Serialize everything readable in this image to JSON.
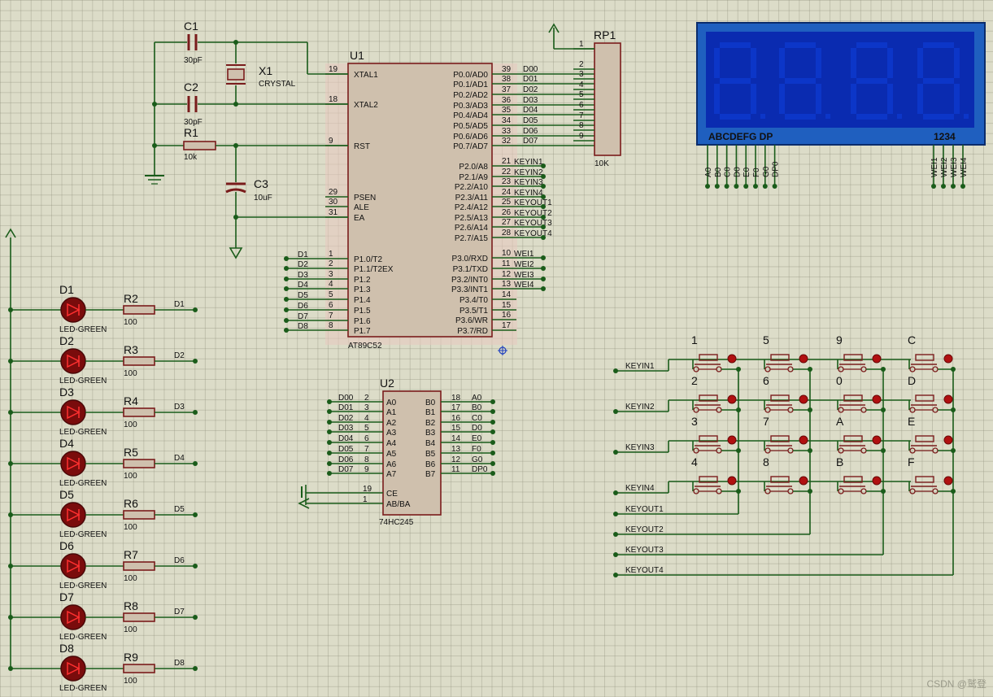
{
  "mcu": {
    "ref": "U1",
    "part": "AT89C52",
    "left_pins": [
      {
        "num": "19",
        "name": "XTAL1"
      },
      {
        "num": "18",
        "name": "XTAL2"
      },
      {
        "num": "9",
        "name": "RST"
      },
      {
        "num": "29",
        "name": "PSEN"
      },
      {
        "num": "30",
        "name": "ALE"
      },
      {
        "num": "31",
        "name": "EA"
      },
      {
        "num": "1",
        "name": "P1.0/T2"
      },
      {
        "num": "2",
        "name": "P1.1/T2EX"
      },
      {
        "num": "3",
        "name": "P1.2"
      },
      {
        "num": "4",
        "name": "P1.3"
      },
      {
        "num": "5",
        "name": "P1.4"
      },
      {
        "num": "6",
        "name": "P1.5"
      },
      {
        "num": "7",
        "name": "P1.6"
      },
      {
        "num": "8",
        "name": "P1.7"
      }
    ],
    "right_pins": [
      {
        "num": "39",
        "name": "P0.0/AD0",
        "net": "D00"
      },
      {
        "num": "38",
        "name": "P0.1/AD1",
        "net": "D01"
      },
      {
        "num": "37",
        "name": "P0.2/AD2",
        "net": "D02"
      },
      {
        "num": "36",
        "name": "P0.3/AD3",
        "net": "D03"
      },
      {
        "num": "35",
        "name": "P0.4/AD4",
        "net": "D04"
      },
      {
        "num": "34",
        "name": "P0.5/AD5",
        "net": "D05"
      },
      {
        "num": "33",
        "name": "P0.6/AD6",
        "net": "D06"
      },
      {
        "num": "32",
        "name": "P0.7/AD7",
        "net": "D07"
      },
      {
        "num": "21",
        "name": "P2.0/A8",
        "net": "KEYIN1"
      },
      {
        "num": "22",
        "name": "P2.1/A9",
        "net": "KEYIN2"
      },
      {
        "num": "23",
        "name": "P2.2/A10",
        "net": "KEYIN3"
      },
      {
        "num": "24",
        "name": "P2.3/A11",
        "net": "KEYIN4"
      },
      {
        "num": "25",
        "name": "P2.4/A12",
        "net": "KEYOUT1"
      },
      {
        "num": "26",
        "name": "P2.5/A13",
        "net": "KEYOUT2"
      },
      {
        "num": "27",
        "name": "P2.6/A14",
        "net": "KEYOUT3"
      },
      {
        "num": "28",
        "name": "P2.7/A15",
        "net": "KEYOUT4"
      },
      {
        "num": "10",
        "name": "P3.0/RXD",
        "net": "WEI1"
      },
      {
        "num": "11",
        "name": "P3.1/TXD",
        "net": "WEI2"
      },
      {
        "num": "12",
        "name": "P3.2/INT0",
        "net": "WEI3"
      },
      {
        "num": "13",
        "name": "P3.3/INT1",
        "net": "WEI4"
      },
      {
        "num": "14",
        "name": "P3.4/T0",
        "net": ""
      },
      {
        "num": "15",
        "name": "P3.5/T1",
        "net": ""
      },
      {
        "num": "16",
        "name": "P3.6/WR",
        "net": ""
      },
      {
        "num": "17",
        "name": "P3.7/RD",
        "net": ""
      }
    ],
    "p1_nets": [
      "D1",
      "D2",
      "D3",
      "D4",
      "D5",
      "D6",
      "D7",
      "D8"
    ]
  },
  "osc": {
    "c1": {
      "ref": "C1",
      "value": "30pF"
    },
    "c2": {
      "ref": "C2",
      "value": "30pF"
    },
    "x1": {
      "ref": "X1",
      "value": "CRYSTAL"
    },
    "r1": {
      "ref": "R1",
      "value": "10k"
    },
    "c3": {
      "ref": "C3",
      "value": "10uF"
    }
  },
  "rp1": {
    "ref": "RP1",
    "value": "10K",
    "pins": [
      "1",
      "2",
      "3",
      "4",
      "5",
      "6",
      "7",
      "8",
      "9"
    ]
  },
  "display": {
    "seg_caption": "ABCDEFG  DP",
    "digit_caption": "1234",
    "seg_pins": [
      "A0",
      "B0",
      "C0",
      "D0",
      "E0",
      "F0",
      "G0",
      "DP0"
    ],
    "dig_pins": [
      "WEI1",
      "WEI2",
      "WEI3",
      "WEI4"
    ],
    "colors": {
      "frame": "#1f5fbf",
      "screen": "#0a2bb0",
      "segment": "#0c36c8"
    }
  },
  "buffer": {
    "ref": "U2",
    "part": "74HC245",
    "a_pins": [
      {
        "num": "2",
        "name": "A0",
        "net": "D00"
      },
      {
        "num": "3",
        "name": "A1",
        "net": "D01"
      },
      {
        "num": "4",
        "name": "A2",
        "net": "D02"
      },
      {
        "num": "5",
        "name": "A3",
        "net": "D03"
      },
      {
        "num": "6",
        "name": "A4",
        "net": "D04"
      },
      {
        "num": "7",
        "name": "A5",
        "net": "D05"
      },
      {
        "num": "8",
        "name": "A6",
        "net": "D06"
      },
      {
        "num": "9",
        "name": "A7",
        "net": "D07"
      }
    ],
    "b_pins": [
      {
        "num": "18",
        "name": "B0",
        "net": "A0"
      },
      {
        "num": "17",
        "name": "B1",
        "net": "B0"
      },
      {
        "num": "16",
        "name": "B2",
        "net": "C0"
      },
      {
        "num": "15",
        "name": "B3",
        "net": "D0"
      },
      {
        "num": "14",
        "name": "B4",
        "net": "E0"
      },
      {
        "num": "13",
        "name": "B5",
        "net": "F0"
      },
      {
        "num": "12",
        "name": "B6",
        "net": "G0"
      },
      {
        "num": "11",
        "name": "B7",
        "net": "DP0"
      }
    ],
    "ctrl_pins": [
      {
        "num": "19",
        "name": "CE"
      },
      {
        "num": "1",
        "name": "AB/BA"
      }
    ]
  },
  "leds": [
    {
      "d": "D1",
      "r": "R2",
      "net": "D1"
    },
    {
      "d": "D2",
      "r": "R3",
      "net": "D2"
    },
    {
      "d": "D3",
      "r": "R4",
      "net": "D3"
    },
    {
      "d": "D4",
      "r": "R5",
      "net": "D4"
    },
    {
      "d": "D5",
      "r": "R6",
      "net": "D5"
    },
    {
      "d": "D6",
      "r": "R7",
      "net": "D6"
    },
    {
      "d": "D7",
      "r": "R8",
      "net": "D7"
    },
    {
      "d": "D8",
      "r": "R9",
      "net": "D8"
    }
  ],
  "led_type": "LED-GREEN",
  "led_res": "100",
  "keypad": {
    "labels": [
      [
        "1",
        "5",
        "9",
        "C"
      ],
      [
        "2",
        "6",
        "0",
        "D"
      ],
      [
        "3",
        "7",
        "A",
        "E"
      ],
      [
        "4",
        "8",
        "B",
        "F"
      ]
    ],
    "rows": [
      "KEYIN1",
      "KEYIN2",
      "KEYIN3",
      "KEYIN4"
    ],
    "cols": [
      "KEYOUT1",
      "KEYOUT2",
      "KEYOUT3",
      "KEYOUT4"
    ]
  },
  "watermark": "CSDN @鹫登"
}
